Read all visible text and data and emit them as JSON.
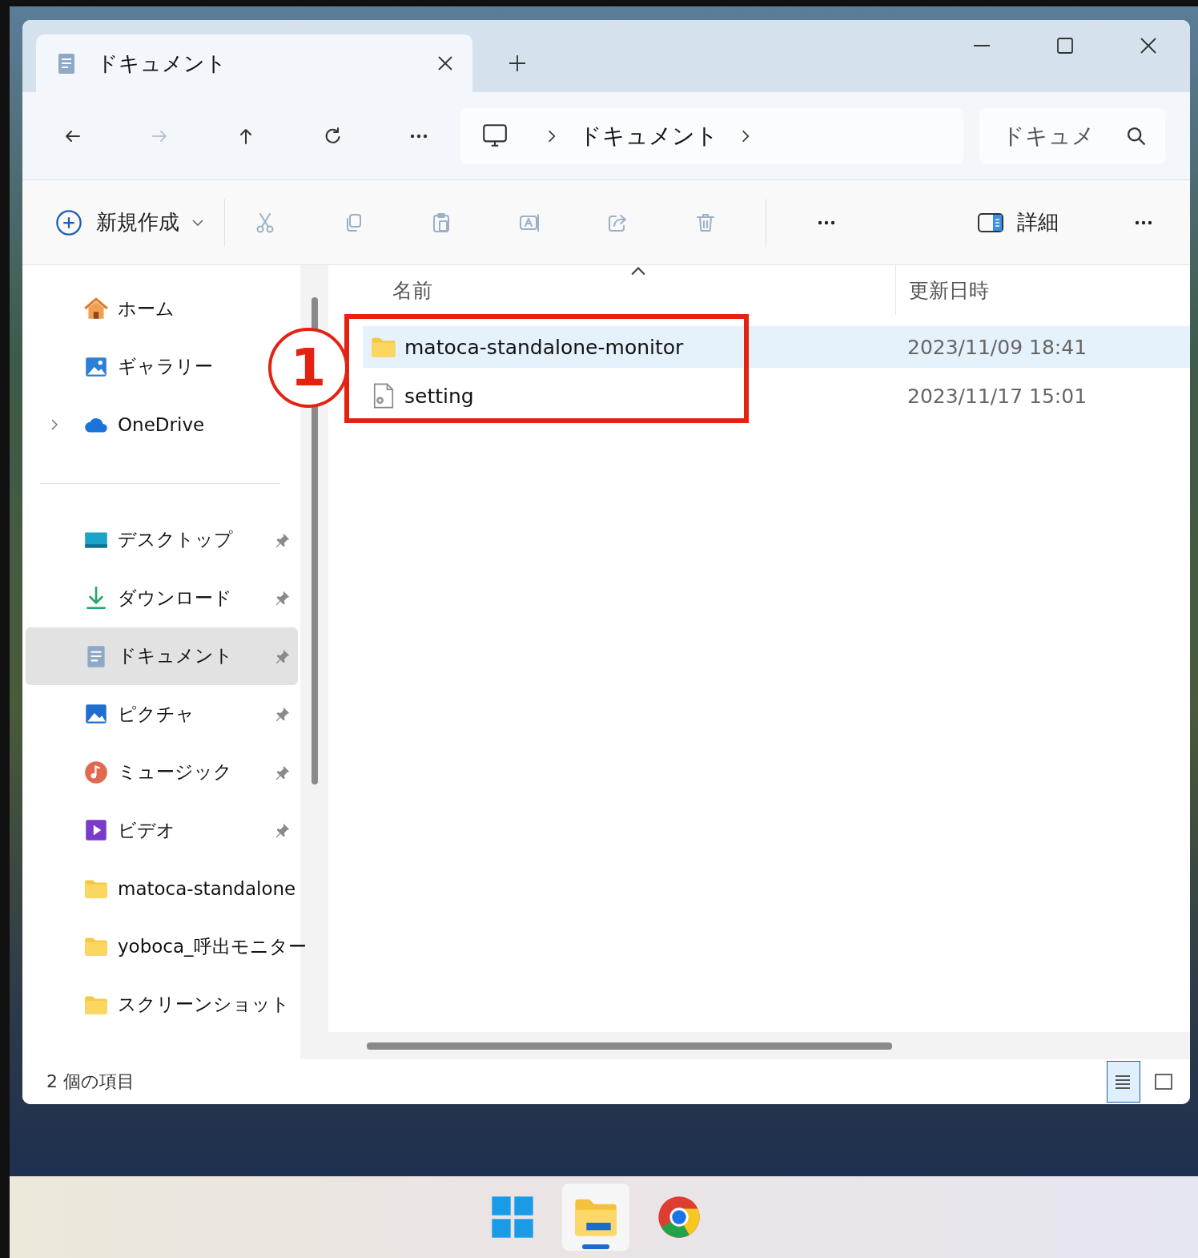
{
  "window": {
    "tab": {
      "title": "ドキュメント",
      "selected": true
    }
  },
  "navigation": [
    {
      "kind": "back",
      "disabled": false
    },
    {
      "kind": "forward",
      "disabled": true
    },
    {
      "kind": "up",
      "disabled": false
    },
    {
      "kind": "refresh",
      "disabled": false
    },
    {
      "kind": "more",
      "disabled": false
    }
  ],
  "address": {
    "segments": [
      "ドキュメント"
    ]
  },
  "search": {
    "placeholder": "ドキュメ"
  },
  "toolbar": {
    "new_label": "新規作成",
    "commands": [
      {
        "kind": "cut",
        "disabled": true
      },
      {
        "kind": "copy",
        "disabled": true
      },
      {
        "kind": "paste",
        "disabled": true
      },
      {
        "kind": "rename",
        "disabled": true
      },
      {
        "kind": "share",
        "disabled": true
      },
      {
        "kind": "delete",
        "disabled": true
      },
      {
        "kind": "more",
        "disabled": false
      }
    ],
    "details_label": "詳細"
  },
  "sidebar": {
    "groups": [
      [
        {
          "label": "ホーム",
          "kind": "home",
          "expandable": false,
          "pinned": false,
          "selected": false
        },
        {
          "label": "ギャラリー",
          "kind": "gallery",
          "expandable": false,
          "pinned": false,
          "selected": false
        },
        {
          "label": "OneDrive",
          "kind": "cloud",
          "expandable": true,
          "pinned": false,
          "selected": false
        }
      ],
      [
        {
          "label": "デスクトップ",
          "kind": "desktop",
          "expandable": false,
          "pinned": true,
          "selected": false
        },
        {
          "label": "ダウンロード",
          "kind": "download",
          "expandable": false,
          "pinned": true,
          "selected": false
        },
        {
          "label": "ドキュメント",
          "kind": "documents",
          "expandable": false,
          "pinned": true,
          "selected": true
        },
        {
          "label": "ピクチャ",
          "kind": "pictures",
          "expandable": false,
          "pinned": true,
          "selected": false
        },
        {
          "label": "ミュージック",
          "kind": "music",
          "expandable": false,
          "pinned": true,
          "selected": false
        },
        {
          "label": "ビデオ",
          "kind": "video",
          "expandable": false,
          "pinned": true,
          "selected": false
        },
        {
          "label": "matoca-standalone",
          "kind": "folder",
          "expandable": false,
          "pinned": false,
          "selected": false
        },
        {
          "label": "yoboca_呼出モニター",
          "kind": "folder",
          "expandable": false,
          "pinned": false,
          "selected": false
        },
        {
          "label": "スクリーンショット",
          "kind": "folder",
          "expandable": false,
          "pinned": false,
          "selected": false
        }
      ]
    ]
  },
  "columns": [
    {
      "label": "名前",
      "sorted": true
    },
    {
      "label": "更新日時",
      "sorted": false
    }
  ],
  "rows": [
    {
      "name": "matoca-standalone-monitor",
      "kind": "folder",
      "modified": "2023/11/09 18:41",
      "selected": true
    },
    {
      "name": "setting",
      "kind": "settings-file",
      "modified": "2023/11/17 15:01",
      "selected": false
    }
  ],
  "callout": {
    "number": "1"
  },
  "status_bar": {
    "count": "2 個の項目",
    "views": [
      {
        "kind": "details",
        "selected": true
      },
      {
        "kind": "tiles",
        "selected": false
      }
    ]
  },
  "taskbar": [
    {
      "kind": "start",
      "active": false
    },
    {
      "kind": "explorer",
      "active": true
    },
    {
      "kind": "browser",
      "active": false
    }
  ]
}
